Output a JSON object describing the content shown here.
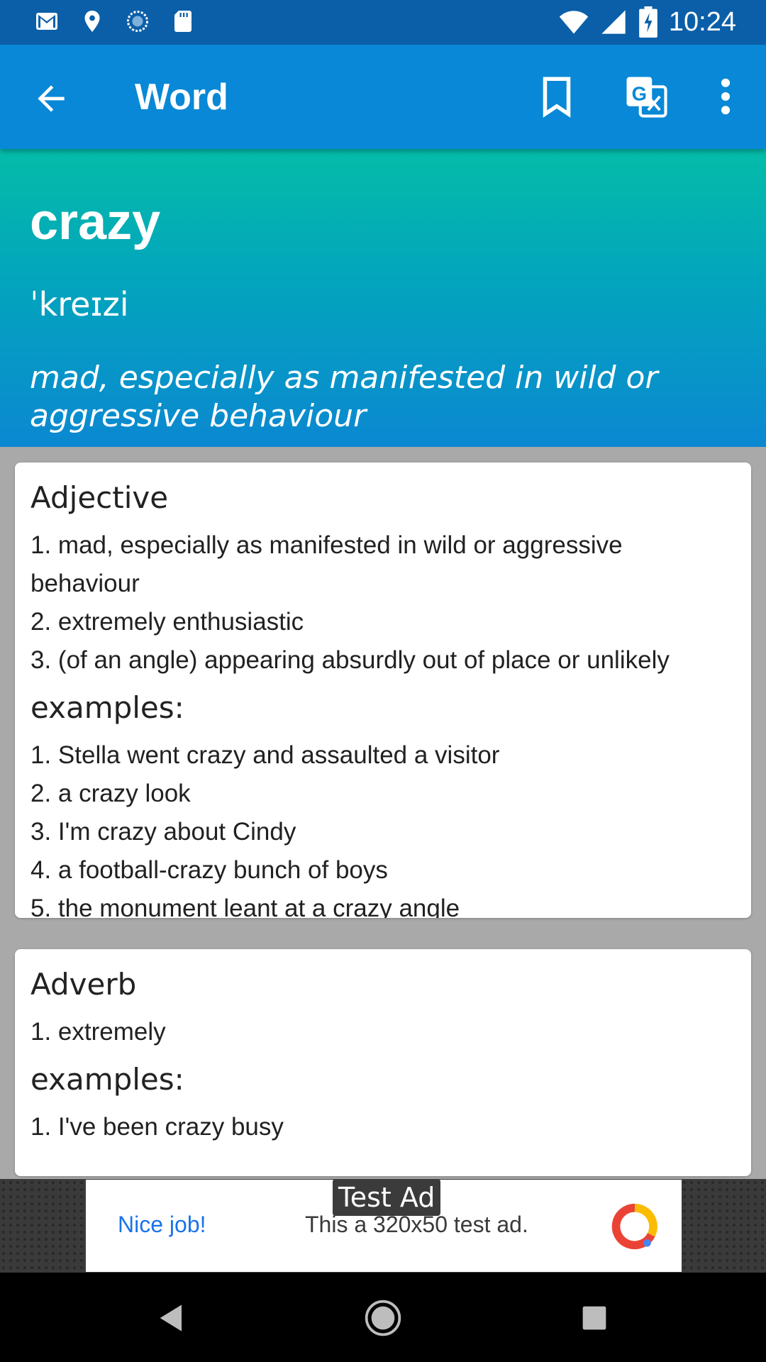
{
  "status_bar": {
    "time": "10:24",
    "left_icons": [
      "gmail-icon",
      "location-pin-icon",
      "sync-circle-icon",
      "sd-card-icon"
    ],
    "right_icons": [
      "wifi-icon",
      "cell-signal-icon",
      "battery-charging-icon"
    ]
  },
  "app_bar": {
    "title": "Word",
    "icons": [
      "back-arrow-icon",
      "bookmark-icon",
      "translate-icon",
      "more-vert-icon"
    ]
  },
  "word": {
    "term": "crazy",
    "pronunciation": "ˈkreɪzi",
    "summary": "mad, especially as manifested in wild or aggressive behaviour"
  },
  "sections": [
    {
      "pos": "Adjective",
      "definitions": [
        "1. mad, especially as manifested in wild or aggressive behaviour",
        "2. extremely enthusiastic",
        "3. (of an angle) appearing absurdly out of place or unlikely"
      ],
      "examples_label": "examples:",
      "examples": [
        "1. Stella went crazy and assaulted a visitor",
        "2. a crazy look",
        "3. I'm crazy about Cindy",
        "4. a football-crazy bunch of boys",
        "5. the monument leant at a crazy angle"
      ]
    },
    {
      "pos": "Adverb",
      "definitions": [
        "1. extremely"
      ],
      "examples_label": "examples:",
      "examples": [
        "1. I've been crazy busy"
      ]
    }
  ],
  "ad": {
    "label": "Test Ad",
    "cta": "Nice job!",
    "text": "This a 320x50 test ad."
  },
  "nav": {
    "icons": [
      "back-triangle-icon",
      "home-circle-icon",
      "recents-square-icon"
    ]
  },
  "colors": {
    "status_bar": "#0b5fa8",
    "app_bar": "#0888d6",
    "hero_top": "#04bca8",
    "hero_bottom": "#0b88d1",
    "background": "#a9a9a9"
  }
}
